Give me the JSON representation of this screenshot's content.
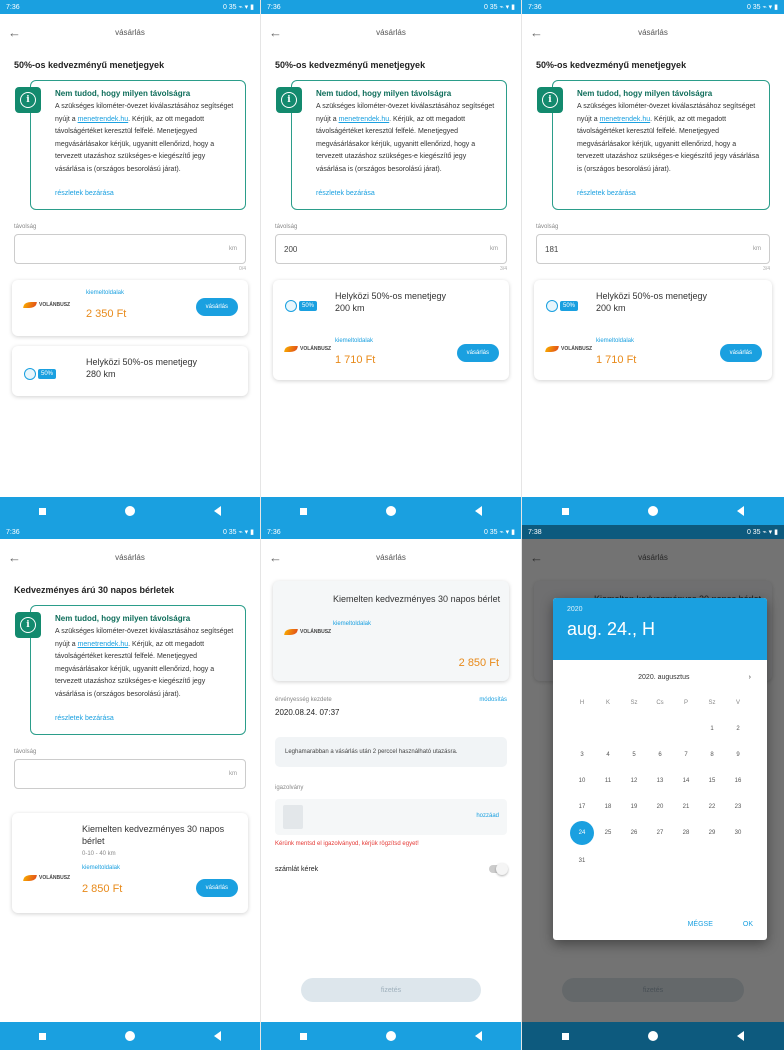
{
  "status": {
    "time": "7:36",
    "time2": "7:38",
    "right": "0 35 ⌁ ▾ ▮"
  },
  "app": {
    "title": "vásárlás",
    "back": "←"
  },
  "info": {
    "head": "Nem tudod, hogy milyen távolságra",
    "text_before": "A szükséges kilométer-övezet kiválasztásához segítséget nyújt a ",
    "link": "menetrendek.hu",
    "text_after": ". Kérjük, az ott megadott távolságértéket keresztül felfelé. Menetjegyed megvásárlásakor kérjük, ugyanitt ellenőrizd, hogy a tervezett utazáshoz szükséges-e kiegészítő jegy vásárlása is (országos besorolású járat).",
    "more": "részletek bezárása"
  },
  "screens": {
    "s1": {
      "section": "50%-os kedvezményű menetjegyek",
      "field_label": "távolság",
      "value": "",
      "unit": "km",
      "counter": "0/4",
      "card1": {
        "brand": "VOLÁNBUSZ",
        "tag": "kiemeltoldalak",
        "price": "2 350 Ft",
        "buy": "vásárlás"
      },
      "card2": {
        "title": "Helyközi 50%-os menetjegy",
        "distance": "280 km",
        "pct": "50%"
      }
    },
    "s2": {
      "section": "50%-os kedvezményű menetjegyek",
      "field_label": "távolság",
      "value": "200",
      "unit": "km",
      "counter": "3/4",
      "card": {
        "title": "Helyközi 50%-os menetjegy",
        "distance": "200 km",
        "pct": "50%",
        "brand": "VOLÁNBUSZ",
        "tag": "kiemeltoldalak",
        "price": "1 710 Ft",
        "buy": "vásárlás"
      }
    },
    "s3": {
      "section": "50%-os kedvezményű menetjegyek",
      "field_label": "távolság",
      "value": "181",
      "unit": "km",
      "counter": "3/4",
      "card": {
        "title": "Helyközi 50%-os menetjegy",
        "distance": "200 km",
        "pct": "50%",
        "brand": "VOLÁNBUSZ",
        "tag": "kiemeltoldalak",
        "price": "1 710 Ft",
        "buy": "vásárlás"
      }
    },
    "s4": {
      "section": "Kedvezményes árú 30 napos bérletek",
      "field_label": "távolság",
      "value": "",
      "unit": "km",
      "card": {
        "title": "Kiemelten kedvezményes 30 napos bérlet",
        "sub": "0-10 - 40 km",
        "brand": "VOLÁNBUSZ",
        "tag": "kiemeltoldalak",
        "price": "2 850 Ft",
        "buy": "vásárlás"
      }
    },
    "s5": {
      "card": {
        "title": "Kiemelten kedvezményes 30 napos bérlet",
        "tag": "kiemeltoldalak",
        "brand": "VOLÁNBUSZ",
        "price": "2 850 Ft"
      },
      "validity_label": "érvényesség kezdete",
      "validity_link": "módosítás",
      "validity_value": "2020.08.24. 07:37",
      "notice": "Leghamarabban a vásárlás után 2 perccel használható utazásra.",
      "card_label": "igazolvány",
      "card_link": "hozzáad",
      "error": "Kérünk mentsd el igazolványod, kérjük rögzítsd egyet!",
      "invoice": "számlát kérek",
      "pay": "fizetés"
    },
    "s6": {
      "year": "2020",
      "date": "aug. 24., H",
      "month": "2020. augusztus",
      "weekdays": [
        "H",
        "K",
        "Sz",
        "Cs",
        "P",
        "Sz",
        "V"
      ],
      "rows": [
        [
          "",
          "",
          "",
          "",
          "",
          "1",
          "2"
        ],
        [
          "3",
          "4",
          "5",
          "6",
          "7",
          "8",
          "9"
        ],
        [
          "10",
          "11",
          "12",
          "13",
          "14",
          "15",
          "16"
        ],
        [
          "17",
          "18",
          "19",
          "20",
          "21",
          "22",
          "23"
        ],
        [
          "24",
          "25",
          "26",
          "27",
          "28",
          "29",
          "30"
        ],
        [
          "31",
          "",
          "",
          "",
          "",
          "",
          ""
        ]
      ],
      "selected": "24",
      "cancel": "MÉGSE",
      "ok": "OK"
    }
  },
  "colors": {
    "accent": "#1aa0e0",
    "teal": "#138a6e",
    "price": "#e88a1a",
    "error": "#e53935"
  }
}
